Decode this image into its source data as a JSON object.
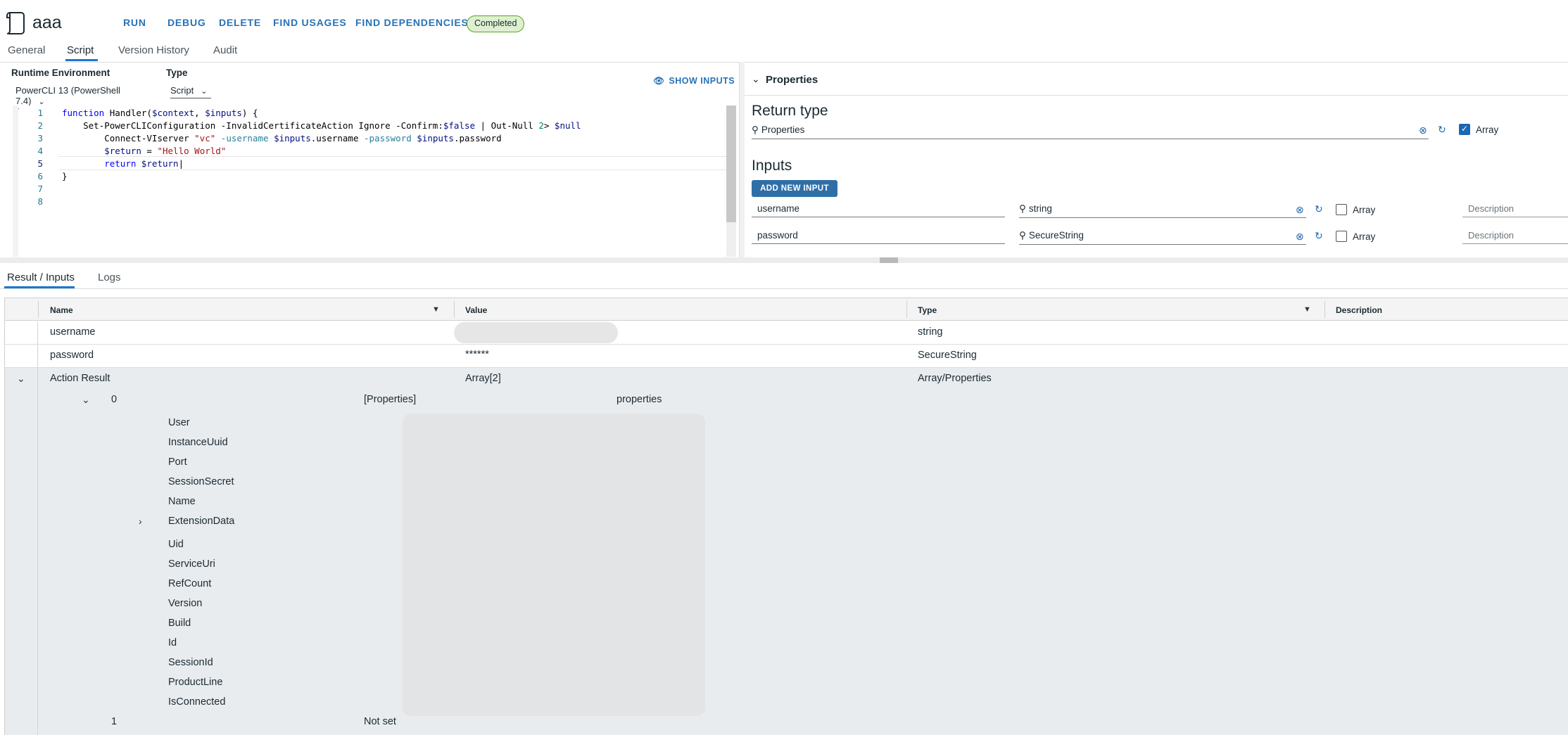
{
  "header": {
    "title": "aaa",
    "actions": [
      "RUN",
      "DEBUG",
      "DELETE",
      "FIND USAGES",
      "FIND DEPENDENCIES"
    ],
    "status": "Completed"
  },
  "tabs": [
    "General",
    "Script",
    "Version History",
    "Audit"
  ],
  "active_tab": "Script",
  "editor": {
    "runtime_label": "Runtime Environment",
    "runtime_value": "PowerCLI 13 (PowerShell 7.4)",
    "type_label": "Type",
    "type_value": "Script",
    "show_inputs": "SHOW INPUTS",
    "line_numbers": [
      "1",
      "2",
      "3",
      "4",
      "5",
      "6",
      "7",
      "8"
    ]
  },
  "properties": {
    "title": "Properties",
    "return_type_heading": "Return type",
    "return_type_value": "Properties",
    "array_label": "Array",
    "inputs_heading": "Inputs",
    "add_input": "ADD NEW INPUT",
    "inputs": [
      {
        "name": "username",
        "type": "string",
        "array": "Array",
        "description": "Description"
      },
      {
        "name": "password",
        "type": "SecureString",
        "array": "Array",
        "description": "Description"
      }
    ]
  },
  "bottom_tabs": [
    "Result / Inputs",
    "Logs"
  ],
  "grid": {
    "headers": [
      "Name",
      "Value",
      "Type",
      "Description"
    ],
    "rows": [
      {
        "name": "username",
        "value": "",
        "type": "string"
      },
      {
        "name": "password",
        "value": "******",
        "type": "SecureString"
      },
      {
        "name": "Action Result",
        "value": "Array[2]",
        "type": "Array/Properties"
      }
    ],
    "item0": {
      "index": "0",
      "value": "[Properties]",
      "type": "properties"
    },
    "props": [
      "User",
      "InstanceUuid",
      "Port",
      "SessionSecret",
      "Name",
      "ExtensionData",
      "Uid",
      "ServiceUri",
      "RefCount",
      "Version",
      "Build",
      "Id",
      "SessionId",
      "ProductLine",
      "IsConnected"
    ],
    "item1": {
      "index": "1",
      "value": "Not set"
    }
  }
}
